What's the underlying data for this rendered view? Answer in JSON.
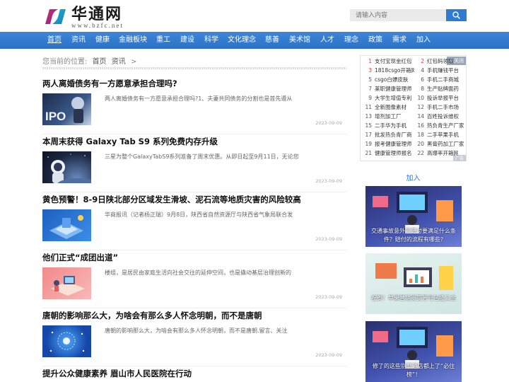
{
  "header": {
    "brand_name": "华通网",
    "brand_domain": "www.bzfc.net",
    "search_placeholder": "请输入内容"
  },
  "nav": [
    "首页",
    "资讯",
    "健康",
    "金融板块",
    "重工",
    "建设",
    "科学",
    "文化理念",
    "慈善",
    "美术馆",
    "人才",
    "理念",
    "政策",
    "需求",
    "加入"
  ],
  "breadcrumb": {
    "prefix": "您当前的位置:",
    "home": "首页",
    "section": "资讯",
    "separator": ">"
  },
  "articles": [
    {
      "title": "两人离婚债务有一方愿意承担合理吗?",
      "summary": "两人离婚债务有一方愿意承担合理吗?1、夫妻共同债务的分割也是首先遵从",
      "date": "2023-09-09",
      "thumb_text": "IPO"
    },
    {
      "title": "本周末获得 Galaxy Tab S9 系列免费内存升级",
      "summary": "三星为整个GalaxyTabS9系列准备了周末优惠。从即日起至9月11日，无论您",
      "date": "2023-09-09",
      "thumb_text": ""
    },
    {
      "title": "黄色预警！8-9日陕北部分区域发生滑坡、泥石流等地质灾害的风险较高",
      "summary": "华商报讯（记者杨正瑞）9月8日，陕西省自然资源厅与陕西省气象局联合发",
      "date": "2023-09-09",
      "thumb_text": ""
    },
    {
      "title": "他们正式“成团出道”",
      "summary": "楼组，是居民由家庭生活向社会交往的延伸空间，也是撬动基层治理创新的",
      "date": "2023-09-09",
      "thumb_text": ""
    },
    {
      "title": "唐朝的影响那么大，为啥会有那么多人怀念明朝，而不是唐朝",
      "summary": "唐朝的影响那么大，为啥会有那么多人怀念明朝，而不是唐朝.留言、关注",
      "date": "2023-09-09",
      "thumb_text": ""
    },
    {
      "title": "提升公众健康素养 眉山市人民医院在行动",
      "summary": "",
      "date": "",
      "thumb_text": ""
    }
  ],
  "hot": {
    "tag": "X 关闭",
    "tag2": "广告",
    "items": [
      {
        "n": "1",
        "t": "支付宝现金红包"
      },
      {
        "n": "2",
        "t": "红包码领取"
      },
      {
        "n": "3",
        "t": "1818csgo开箱网"
      },
      {
        "n": "4",
        "t": "手机赚钱平台"
      },
      {
        "n": "5",
        "t": "csgo白嫖皮肤"
      },
      {
        "n": "6",
        "t": "手机二手商城"
      },
      {
        "n": "7",
        "t": "莱职健康管理师"
      },
      {
        "n": "8",
        "t": "生产贴牌面药"
      },
      {
        "n": "9",
        "t": "大学生增值专利"
      },
      {
        "n": "10",
        "t": "投诉举报平台"
      },
      {
        "n": "11",
        "t": "全新图像素材"
      },
      {
        "n": "12",
        "t": "手机二手市场"
      },
      {
        "n": "13",
        "t": "增剂加工厂"
      },
      {
        "n": "14",
        "t": "百姓投诉维权"
      },
      {
        "n": "15",
        "t": "二手华为手机"
      },
      {
        "n": "16",
        "t": "热负青生产厂家"
      },
      {
        "n": "17",
        "t": "批发热负青厂商"
      },
      {
        "n": "18",
        "t": "二手苹果手机"
      },
      {
        "n": "19",
        "t": "报考健康管理师"
      },
      {
        "n": "20",
        "t": "黑膏药加工厂家"
      },
      {
        "n": "21",
        "t": "健康管理师报名"
      },
      {
        "n": "22",
        "t": "高爆率开箱网"
      }
    ]
  },
  "sidebar": {
    "label": "加入",
    "cards": [
      {
        "caption": "交通事故意外险赔付要满足什么条件？赔付的流程有哪些?"
      },
      {
        "caption": "祝贺！苹果营销贵贾芳号包揽三金"
      },
      {
        "caption": "修了的这些别墅酒店都上了“必住榜”！"
      }
    ]
  },
  "colors": {
    "nav_blue": "#2e7bd3",
    "accent_red": "#e23a3a"
  }
}
